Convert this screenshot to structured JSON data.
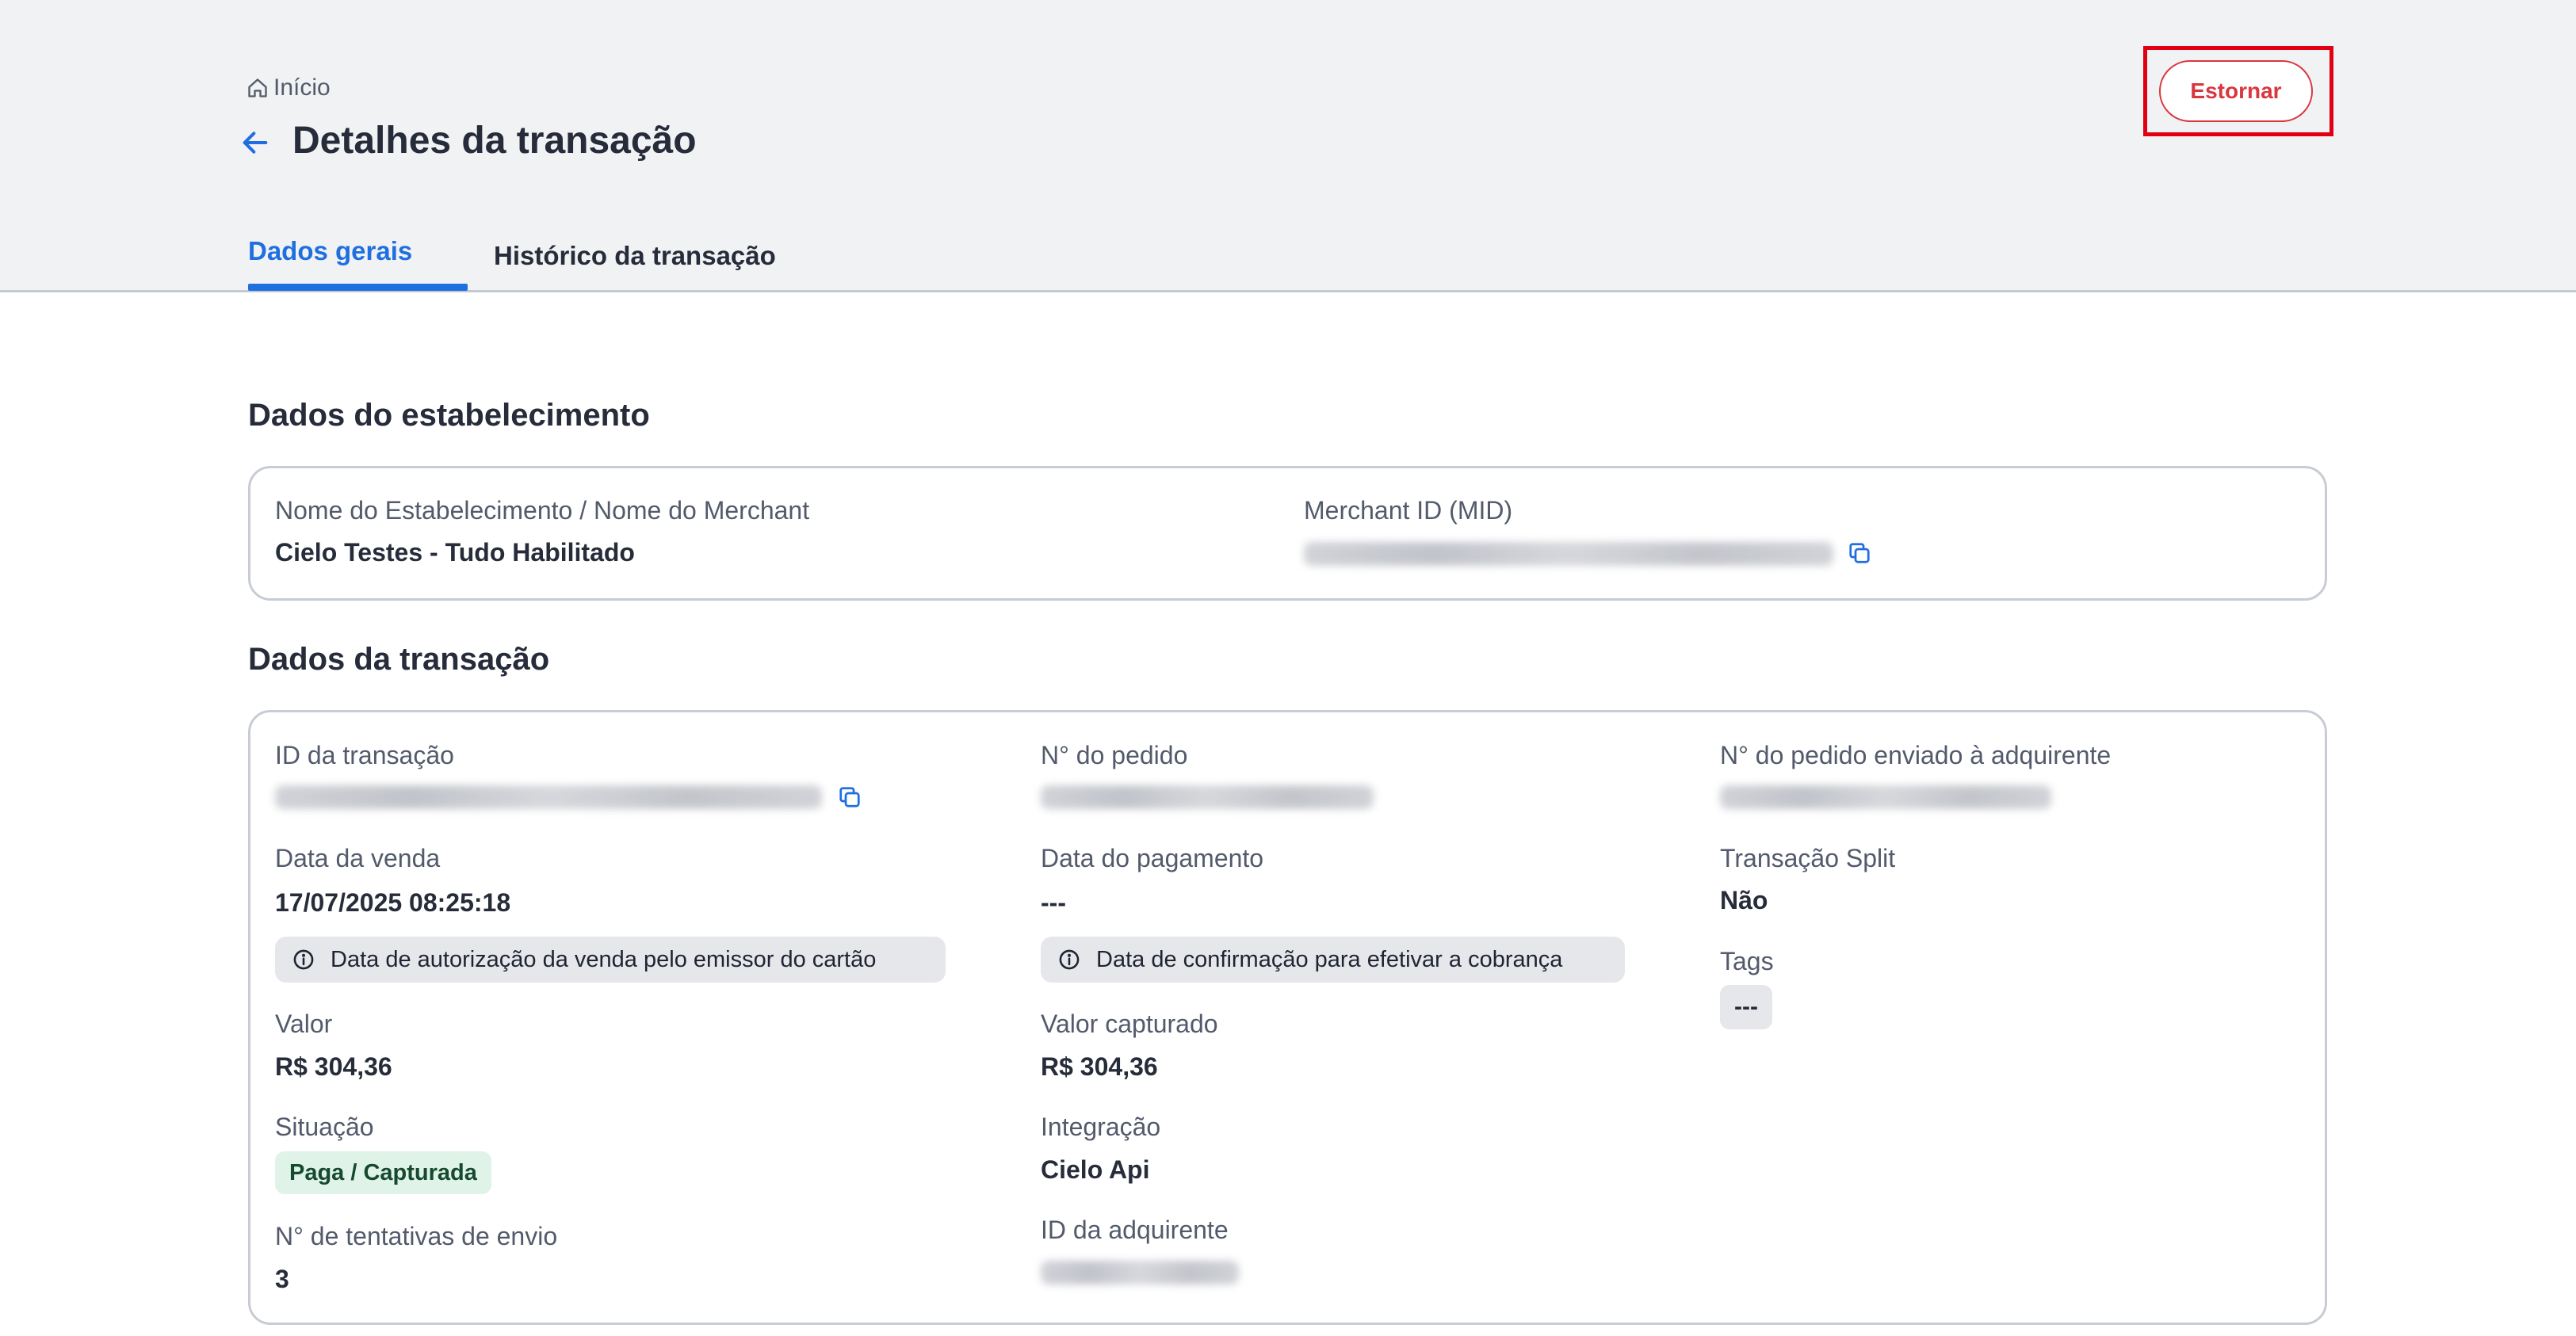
{
  "breadcrumb": {
    "label": "Início"
  },
  "page": {
    "title": "Detalhes da transação"
  },
  "actions": {
    "refund_label": "Estornar"
  },
  "tabs": [
    {
      "label": "Dados gerais",
      "active": true
    },
    {
      "label": "Histórico da transação",
      "active": false
    }
  ],
  "merchant_section": {
    "title": "Dados do estabelecimento",
    "name_label": "Nome do Estabelecimento / Nome do Merchant",
    "name_value": "Cielo Testes - Tudo Habilitado",
    "mid_label": "Merchant ID (MID)"
  },
  "transaction_section": {
    "title": "Dados da transação",
    "transaction_id_label": "ID da transação",
    "order_number_label": "N° do pedido",
    "acquirer_order_label": "N° do pedido enviado à adquirente",
    "sale_date_label": "Data da venda",
    "sale_date_value": "17/07/2025 08:25:18",
    "sale_date_info": "Data de autorização da venda pelo emissor do cartão",
    "payment_date_label": "Data do pagamento",
    "payment_date_value": "---",
    "payment_date_info": "Data de confirmação para efetivar a cobrança",
    "split_label": "Transação Split",
    "split_value": "Não",
    "tags_label": "Tags",
    "tags_value": "---",
    "amount_label": "Valor",
    "amount_value": "R$ 304,36",
    "captured_label": "Valor capturado",
    "captured_value": "R$ 304,36",
    "status_label": "Situação",
    "status_value": "Paga / Capturada",
    "integration_label": "Integração",
    "integration_value": "Cielo Api",
    "attempts_label": "N° de tentativas de envio",
    "attempts_value": "3",
    "acquirer_id_label": "ID da adquirente"
  },
  "colors": {
    "accent": "#1f6fe0",
    "danger": "#d9363e",
    "status_bg": "#dff3e8",
    "header_bg": "#f1f2f4"
  },
  "icons": [
    "home-icon",
    "arrow-left-icon",
    "copy-icon",
    "info-icon"
  ]
}
